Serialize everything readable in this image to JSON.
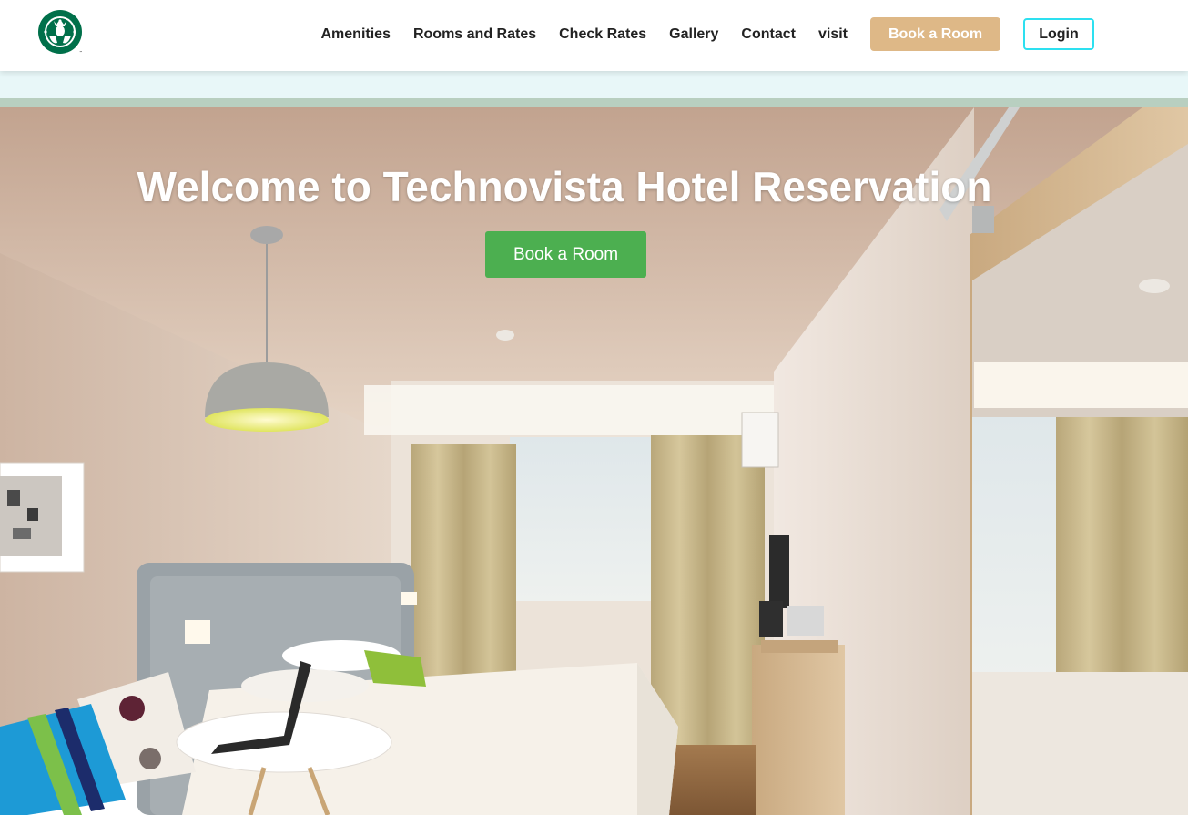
{
  "header": {
    "logo_icon": "starbucks-siren-logo",
    "nav_links": [
      "Amenities",
      "Rooms and Rates",
      "Check Rates",
      "Gallery",
      "Contact",
      "visit"
    ],
    "book_button_label": "Book a Room",
    "login_button_label": "Login"
  },
  "hero": {
    "title": "Welcome to Technovista Hotel Reservation",
    "cta_label": "Book a Room"
  },
  "colors": {
    "nav_book_bg": "#deb887",
    "login_border": "#2de0f0",
    "hero_cta_bg": "#4caf50",
    "strip_light": "#e8f7f8",
    "strip_green": "#b8cfc0"
  }
}
